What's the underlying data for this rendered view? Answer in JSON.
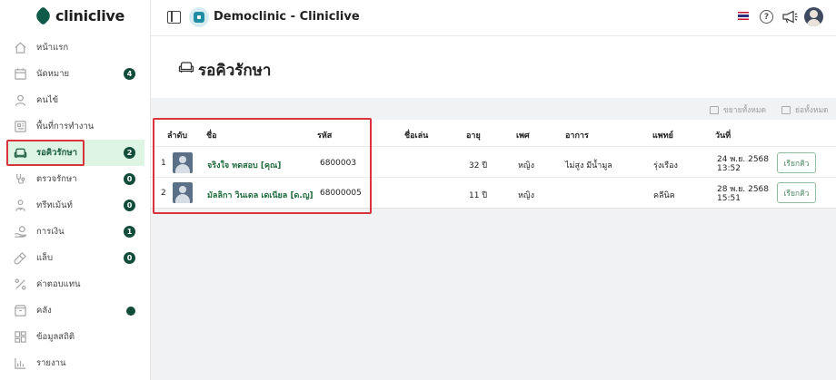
{
  "brand": {
    "name": "cliniclive"
  },
  "sidebar": {
    "items": [
      {
        "label": "หน้าแรก",
        "icon": "home-icon"
      },
      {
        "label": "นัดหมาย",
        "icon": "calendar-icon",
        "badge": "4"
      },
      {
        "label": "คนไข้",
        "icon": "user-icon"
      },
      {
        "label": "พื้นที่การทำงาน",
        "icon": "workspace-icon"
      },
      {
        "label": "รอคิวรักษา",
        "icon": "sofa-icon",
        "badge": "2",
        "active": true
      },
      {
        "label": "ตรวจรักษา",
        "icon": "stethoscope-icon",
        "badge": "0"
      },
      {
        "label": "ทรีทเม้นท์",
        "icon": "treatment-icon",
        "badge": "0"
      },
      {
        "label": "การเงิน",
        "icon": "finance-icon",
        "badge": "1"
      },
      {
        "label": "แล็บ",
        "icon": "lab-icon",
        "badge": "0"
      },
      {
        "label": "ค่าตอบแทน",
        "icon": "percent-icon"
      },
      {
        "label": "คลัง",
        "icon": "inventory-icon",
        "dot": true
      },
      {
        "label": "ข้อมูลสถิติ",
        "icon": "stats-icon"
      },
      {
        "label": "รายงาน",
        "icon": "report-icon"
      }
    ]
  },
  "header": {
    "clinic_name": "Democlinic - Cliniclive",
    "help_label": "?"
  },
  "page": {
    "title": "รอคิวรักษา",
    "expand_all": "ขยายทั้งหมด",
    "collapse_all": "ย่อทั้งหมด"
  },
  "table": {
    "columns": [
      "ลำดับ",
      "ชื่อ",
      "รหัส",
      "ชื่อเล่น",
      "อายุ",
      "เพศ",
      "อาการ",
      "แพทย์",
      "วันที่"
    ],
    "rows": [
      {
        "order": "1",
        "name": "จริงใจ  ทดสอบ [คุณ]",
        "code": "6800003",
        "nickname": "",
        "age": "32 ปี",
        "gender": "หญิง",
        "symptom": "ไม่สูง มีน้ำมูล",
        "doctor": "รุ่งเรือง",
        "date": "24 พ.ย. 2568",
        "time": "13:52",
        "action": "เรียกคิว"
      },
      {
        "order": "2",
        "name": "มัลลิกา วินเดล เดเนียล  [ด.ญ]",
        "code": "68000005",
        "nickname": "",
        "age": "11 ปี",
        "gender": "หญิง",
        "symptom": "",
        "doctor": "คลีนิค",
        "date": "28 พ.ย. 2568",
        "time": "15:51",
        "action": "เรียกคิว"
      }
    ]
  },
  "colors": {
    "brand": "#0f5a48",
    "active_bg": "#dff5e3",
    "badge": "#124d3c",
    "highlight": "#d9343b"
  }
}
